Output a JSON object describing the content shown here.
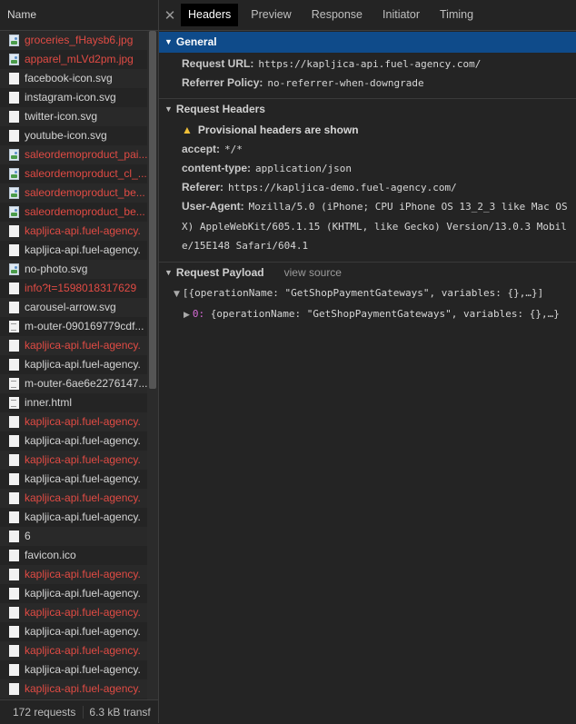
{
  "requests": {
    "column_header": "Name",
    "rows": [
      {
        "name": "groceries_fHaysb6.jpg",
        "status": "error",
        "icon": "image-icon"
      },
      {
        "name": "apparel_mLVd2pm.jpg",
        "status": "error",
        "icon": "image-icon"
      },
      {
        "name": "facebook-icon.svg",
        "status": "ok",
        "icon": "file-icon"
      },
      {
        "name": "instagram-icon.svg",
        "status": "ok",
        "icon": "file-icon"
      },
      {
        "name": "twitter-icon.svg",
        "status": "ok",
        "icon": "file-icon"
      },
      {
        "name": "youtube-icon.svg",
        "status": "ok",
        "icon": "file-icon"
      },
      {
        "name": "saleordemoproduct_pai...",
        "status": "error",
        "icon": "image-icon"
      },
      {
        "name": "saleordemoproduct_cl_...",
        "status": "error",
        "icon": "image-icon"
      },
      {
        "name": "saleordemoproduct_be...",
        "status": "error",
        "icon": "image-icon"
      },
      {
        "name": "saleordemoproduct_be...",
        "status": "error",
        "icon": "image-icon"
      },
      {
        "name": "kapljica-api.fuel-agency.",
        "status": "error",
        "icon": "file-icon"
      },
      {
        "name": "kapljica-api.fuel-agency.",
        "status": "ok",
        "icon": "file-icon"
      },
      {
        "name": "no-photo.svg",
        "status": "ok",
        "icon": "image-icon"
      },
      {
        "name": "info?t=1598018317629",
        "status": "error",
        "icon": "file-icon"
      },
      {
        "name": "carousel-arrow.svg",
        "status": "ok",
        "icon": "file-icon"
      },
      {
        "name": "m-outer-090169779cdf...",
        "status": "ok",
        "icon": "document-icon"
      },
      {
        "name": "kapljica-api.fuel-agency.",
        "status": "error",
        "icon": "file-icon"
      },
      {
        "name": "kapljica-api.fuel-agency.",
        "status": "ok",
        "icon": "file-icon"
      },
      {
        "name": "m-outer-6ae6e2276147...",
        "status": "ok",
        "icon": "document-icon"
      },
      {
        "name": "inner.html",
        "status": "ok",
        "icon": "document-icon"
      },
      {
        "name": "kapljica-api.fuel-agency.",
        "status": "error",
        "icon": "file-icon"
      },
      {
        "name": "kapljica-api.fuel-agency.",
        "status": "ok",
        "icon": "file-icon"
      },
      {
        "name": "kapljica-api.fuel-agency.",
        "status": "error",
        "icon": "file-icon"
      },
      {
        "name": "kapljica-api.fuel-agency.",
        "status": "ok",
        "icon": "file-icon"
      },
      {
        "name": "kapljica-api.fuel-agency.",
        "status": "error",
        "icon": "file-icon"
      },
      {
        "name": "kapljica-api.fuel-agency.",
        "status": "ok",
        "icon": "file-icon"
      },
      {
        "name": "6",
        "status": "ok",
        "icon": "file-icon"
      },
      {
        "name": "favicon.ico",
        "status": "ok",
        "icon": "file-icon"
      },
      {
        "name": "kapljica-api.fuel-agency.",
        "status": "error",
        "icon": "file-icon"
      },
      {
        "name": "kapljica-api.fuel-agency.",
        "status": "ok",
        "icon": "file-icon"
      },
      {
        "name": "kapljica-api.fuel-agency.",
        "status": "error",
        "icon": "file-icon"
      },
      {
        "name": "kapljica-api.fuel-agency.",
        "status": "ok",
        "icon": "file-icon"
      },
      {
        "name": "kapljica-api.fuel-agency.",
        "status": "error",
        "icon": "file-icon"
      },
      {
        "name": "kapljica-api.fuel-agency.",
        "status": "ok",
        "icon": "file-icon"
      },
      {
        "name": "kapljica-api.fuel-agency.",
        "status": "error",
        "icon": "file-icon"
      }
    ],
    "footer": {
      "count": "172 requests",
      "transfer": "6.3 kB transf"
    }
  },
  "tabs": {
    "close_glyph": "✕",
    "items": [
      "Headers",
      "Preview",
      "Response",
      "Initiator",
      "Timing"
    ],
    "active": "Headers"
  },
  "general": {
    "title": "General",
    "request_url_key": "Request URL:",
    "request_url": "https://kapljica-api.fuel-agency.com/",
    "referrer_policy_key": "Referrer Policy:",
    "referrer_policy": "no-referrer-when-downgrade"
  },
  "request_headers": {
    "title": "Request Headers",
    "warning": "Provisional headers are shown",
    "accept_key": "accept:",
    "accept": "*/*",
    "content_type_key": "content-type:",
    "content_type": "application/json",
    "referer_key": "Referer:",
    "referer": "https://kapljica-demo.fuel-agency.com/",
    "user_agent_key": "User-Agent:",
    "user_agent": "Mozilla/5.0 (iPhone; CPU iPhone OS 13_2_3 like Mac OS X) AppleWebKit/605.1.15 (KHTML, like Gecko) Version/13.0.3 Mobile/15E148 Safari/604.1"
  },
  "payload": {
    "title": "Request Payload",
    "view_source": "view source",
    "line1": "[{operationName: \"GetShopPaymentGateways\", variables: {},…}]",
    "line2_index": "0:",
    "line2": "{operationName: \"GetShopPaymentGateways\", variables: {},…}"
  },
  "colors": {
    "selected": "#0f4b8a",
    "error_text": "#e14b44",
    "warning": "#f0c038"
  }
}
